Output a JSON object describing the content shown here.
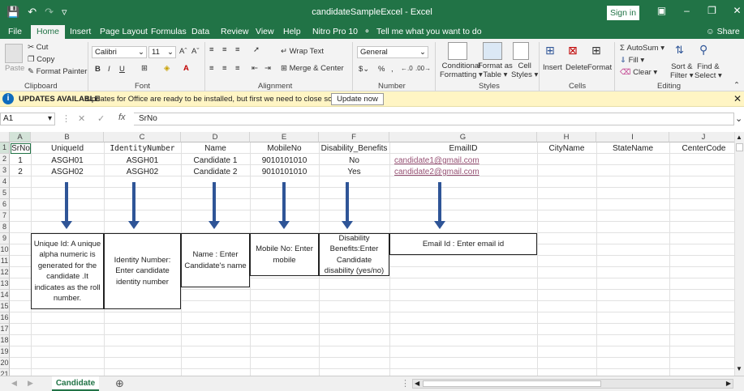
{
  "titlebar": {
    "title": "candidateSampleExcel - Excel",
    "signin": "Sign in"
  },
  "tabs": [
    "File",
    "Home",
    "Insert",
    "Page Layout",
    "Formulas",
    "Data",
    "Review",
    "View",
    "Help",
    "Nitro Pro 10"
  ],
  "tell_me": "Tell me what you want to do",
  "share": "Share",
  "ribbon": {
    "clipboard": {
      "label": "Clipboard",
      "paste": "Paste",
      "cut": "Cut",
      "copy": "Copy",
      "format_painter": "Format Painter"
    },
    "font": {
      "label": "Font",
      "name": "Calibri",
      "size": "11"
    },
    "alignment": {
      "label": "Alignment",
      "wrap": "Wrap Text",
      "merge": "Merge & Center"
    },
    "number": {
      "label": "Number",
      "format": "General"
    },
    "styles": {
      "label": "Styles",
      "cond1": "Conditional",
      "cond2": "Formatting",
      "fat1": "Format as",
      "fat2": "Table",
      "cs1": "Cell",
      "cs2": "Styles"
    },
    "cells": {
      "label": "Cells",
      "insert": "Insert",
      "delete": "Delete",
      "format": "Format"
    },
    "editing": {
      "label": "Editing",
      "autosum": "AutoSum",
      "fill": "Fill",
      "clear": "Clear",
      "sort1": "Sort &",
      "sort2": "Filter",
      "find1": "Find &",
      "find2": "Select"
    }
  },
  "message": {
    "title": "UPDATES AVAILABLE",
    "text": "Updates for Office are ready to be installed, but first we need to close some apps.",
    "button": "Update now"
  },
  "formula": {
    "namebox": "A1",
    "content": "SrNo"
  },
  "columns": [
    "A",
    "B",
    "C",
    "D",
    "E",
    "F",
    "G",
    "H",
    "I",
    "J"
  ],
  "rows": [
    "1",
    "2",
    "3",
    "4",
    "5",
    "6",
    "7",
    "8",
    "9",
    "10",
    "11",
    "12",
    "13",
    "14",
    "15",
    "16",
    "17",
    "18",
    "19",
    "20",
    "21"
  ],
  "table": {
    "headers": [
      "SrNo",
      "UniqueId",
      "IdentityNumber",
      "Name",
      "MobileNo",
      "Disability_Benefits",
      "EmailID",
      "CityName",
      "StateName",
      "CenterCode"
    ],
    "rows": [
      [
        "1",
        "ASGH01",
        "ASGH01",
        "Candidate 1",
        "9010101010",
        "No",
        "candidate1@gmail.com"
      ],
      [
        "2",
        "ASGH02",
        "ASGH02",
        "Candidate 2",
        "9010101010",
        "Yes",
        "candidate2@gmail.com"
      ]
    ]
  },
  "notes": {
    "unique": "Unique Id: A unique alpha numeric is generated for the candidate .It indicates as the roll number.",
    "identity": "Identity Number: Enter candidate identity number",
    "name": "Name : Enter Candidate's name",
    "mobile": "Mobile No: Enter mobile",
    "disability": "Disability Benefits:Enter Candidate disability (yes/no)",
    "email": "Email Id : Enter email id"
  },
  "sheet": {
    "tab": "Candidate"
  }
}
